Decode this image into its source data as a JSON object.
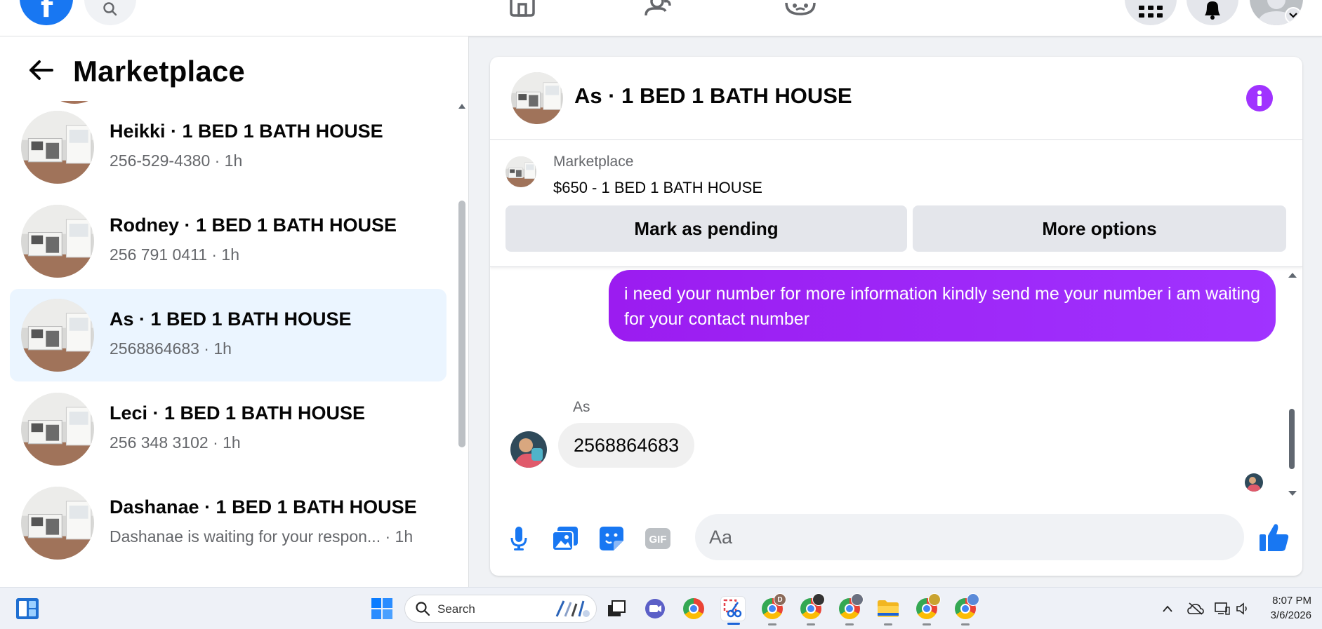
{
  "colors": {
    "facebook_blue": "#1877f2",
    "messenger_purple": "#a033ff",
    "selected_row": "#ebf5ff",
    "secondary_text": "#65676b"
  },
  "topbar": {
    "logo_letter": "f",
    "icons": [
      "search-icon",
      "home-icon",
      "friends-icon",
      "groups-icon",
      "menu-grid-icon",
      "notifications-bell-icon",
      "profile-avatar",
      "chevron-down-icon"
    ]
  },
  "sidebar": {
    "title": "Marketplace",
    "conversations": [
      {
        "name": "Heikki · 1 BED 1 BATH HOUSE",
        "preview": "256-529-4380 · 1h",
        "selected": false
      },
      {
        "name": "Rodney · 1 BED 1 BATH HOUSE",
        "preview": "256 791 0411 · 1h",
        "selected": false
      },
      {
        "name": "As · 1 BED 1 BATH HOUSE",
        "preview": "2568864683 · 1h",
        "selected": true
      },
      {
        "name": "Leci · 1 BED 1 BATH HOUSE",
        "preview": "256 348 3102 · 1h",
        "selected": false
      },
      {
        "name": "Dashanae · 1 BED 1 BATH HOUSE",
        "preview": "Dashanae is waiting for your respon... · 1h",
        "selected": false
      }
    ]
  },
  "conversation": {
    "title": "As · 1 BED 1 BATH HOUSE",
    "listing": {
      "label": "Marketplace",
      "price_title": "$650 - 1 BED 1 BATH HOUSE",
      "mark_pending": "Mark as pending",
      "more_options": "More options"
    },
    "messages": {
      "outgoing": "i need your number for more information kindly send me your number i am waiting for your contact number",
      "sender_name": "As",
      "incoming": "2568864683"
    },
    "composer": {
      "placeholder": "Aa",
      "gif_label": "GIF",
      "icons": [
        "microphone-icon",
        "photo-icon",
        "sticker-icon",
        "gif-icon",
        "emoji-icon",
        "thumbs-up-icon"
      ]
    }
  },
  "taskbar": {
    "search_label": "Search",
    "badges": {
      "chrome_d": "D"
    },
    "time": "8:07 PM",
    "date": "3/6/2026"
  }
}
